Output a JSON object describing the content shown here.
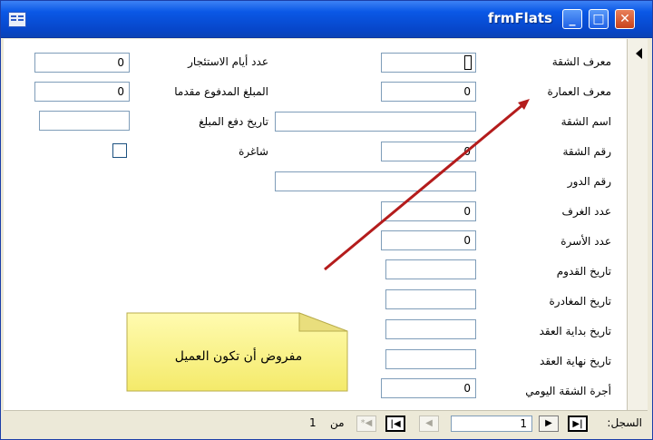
{
  "window": {
    "title": "frmFlats"
  },
  "fields_right": [
    {
      "label": "معرف الشقة",
      "value": ""
    },
    {
      "label": "معرف العمارة",
      "value": "0"
    },
    {
      "label": "اسم الشقة",
      "value": ""
    },
    {
      "label": "رقم الشقة",
      "value": "0"
    },
    {
      "label": "رقم الدور",
      "value": ""
    },
    {
      "label": "عدد الغرف",
      "value": "0"
    },
    {
      "label": "عدد الأسرة",
      "value": "0"
    },
    {
      "label": "تاريخ القدوم",
      "value": ""
    },
    {
      "label": "تاريخ المغادرة",
      "value": ""
    },
    {
      "label": "تاريخ بداية العقد",
      "value": ""
    },
    {
      "label": "تاريخ نهاية العقد",
      "value": ""
    },
    {
      "label": "أجرة الشقة اليومي",
      "value": "0"
    }
  ],
  "fields_left": [
    {
      "label": "عدد أيام الاستئجار",
      "value": "0"
    },
    {
      "label": "المبلغ المدفوع مقدما",
      "value": "0"
    },
    {
      "label": "تاريخ دفع المبلغ",
      "value": ""
    },
    {
      "label": "شاغرة",
      "checked": false
    }
  ],
  "callout": {
    "text": "مفروض أن تكون العميل"
  },
  "navigation": {
    "record_label": "السجل:",
    "current_record": "1",
    "of_label": "من",
    "total_records": "1"
  },
  "icons": {
    "first": "first-record-icon",
    "prev": "prev-record-icon",
    "next": "next-record-icon",
    "last": "last-record-icon",
    "new": "new-record-icon"
  }
}
